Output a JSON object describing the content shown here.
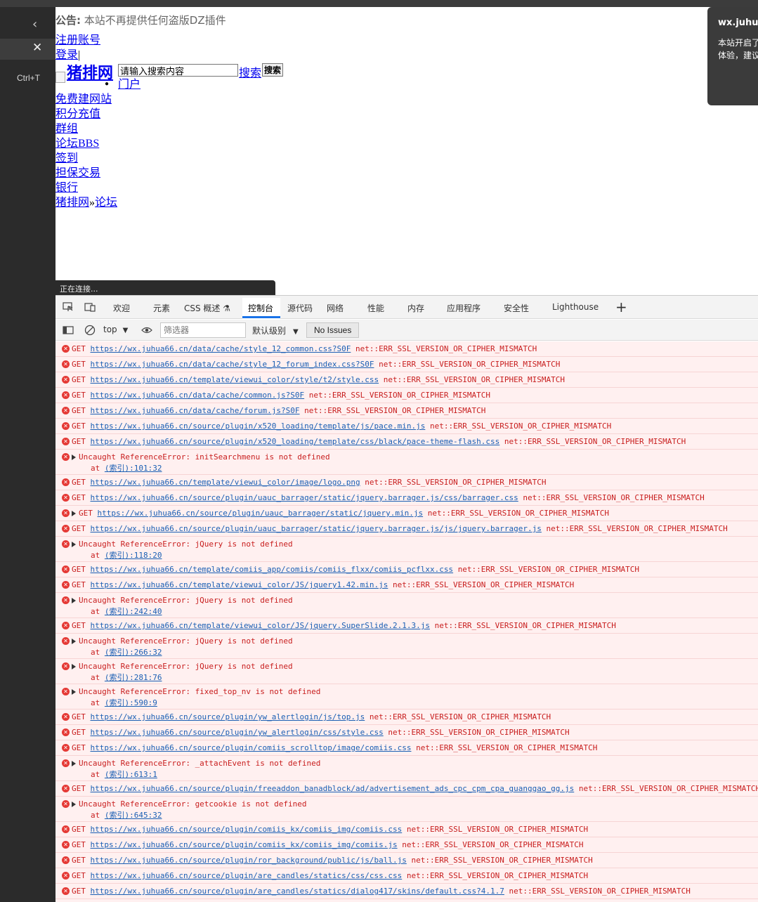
{
  "browser": {
    "shortcut": "Ctrl+T"
  },
  "page": {
    "notice_label": "公告:",
    "notice_text": "本站不再提供任何盗版DZ插件",
    "links_top": [
      "注册账号",
      "登录"
    ],
    "logo_text": "猪排网",
    "search_placeholder": "请输入搜索内容",
    "search_link": "搜索",
    "search_button": "搜索",
    "nav_items": [
      "门户",
      "免费建网站",
      "积分充值",
      "群组",
      "论坛BBS",
      "签到",
      "担保交易",
      "银行"
    ],
    "breadcrumb": [
      "猪排网",
      "»",
      "论坛"
    ],
    "status_text": "正在连接..."
  },
  "popup": {
    "title": "wx.juhua",
    "body": [
      "本站开启了",
      "体验，建议"
    ]
  },
  "devtools": {
    "tabs": [
      "欢迎",
      "元素",
      "CSS 概述",
      "控制台",
      "源代码",
      "网络",
      "性能",
      "内存",
      "应用程序",
      "安全性",
      "Lighthouse"
    ],
    "active_tab": "控制台",
    "context": "top",
    "filter_placeholder": "筛选器",
    "level": "默认级别",
    "issues": "No Issues"
  },
  "console": [
    {
      "kind": "get",
      "method": "GET",
      "url": "https://wx.juhua66.cn/data/cache/style_12_common.css?S0F",
      "error": "net::ERR_SSL_VERSION_OR_CIPHER_MISMATCH"
    },
    {
      "kind": "get",
      "method": "GET",
      "url": "https://wx.juhua66.cn/data/cache/style_12_forum_index.css?S0F",
      "error": "net::ERR_SSL_VERSION_OR_CIPHER_MISMATCH"
    },
    {
      "kind": "get",
      "method": "GET",
      "url": "https://wx.juhua66.cn/template/viewui_color/style/t2/style.css",
      "error": "net::ERR_SSL_VERSION_OR_CIPHER_MISMATCH"
    },
    {
      "kind": "get",
      "method": "GET",
      "url": "https://wx.juhua66.cn/data/cache/common.js?S0F",
      "error": "net::ERR_SSL_VERSION_OR_CIPHER_MISMATCH"
    },
    {
      "kind": "get",
      "method": "GET",
      "url": "https://wx.juhua66.cn/data/cache/forum.js?S0F",
      "error": "net::ERR_SSL_VERSION_OR_CIPHER_MISMATCH"
    },
    {
      "kind": "get",
      "method": "GET",
      "url": "https://wx.juhua66.cn/source/plugin/x520_loading/template/js/pace.min.js",
      "error": "net::ERR_SSL_VERSION_OR_CIPHER_MISMATCH"
    },
    {
      "kind": "get",
      "method": "GET",
      "url": "https://wx.juhua66.cn/source/plugin/x520_loading/template/css/black/pace-theme-flash.css",
      "error": "net::ERR_SSL_VERSION_OR_CIPHER_MISMATCH"
    },
    {
      "kind": "ref",
      "text": "Uncaught ReferenceError: initSearchmenu is not defined",
      "at": "at",
      "loc": "(索引):101:32"
    },
    {
      "kind": "get",
      "method": "GET",
      "url": "https://wx.juhua66.cn/template/viewui_color/image/logo.png",
      "error": "net::ERR_SSL_VERSION_OR_CIPHER_MISMATCH"
    },
    {
      "kind": "get",
      "method": "GET",
      "url": "https://wx.juhua66.cn/source/plugin/uauc_barrager/static/jquery.barrager.js/css/barrager.css",
      "error": "net::ERR_SSL_VERSION_OR_CIPHER_MISMATCH"
    },
    {
      "kind": "getx",
      "method": "GET",
      "url": "https://wx.juhua66.cn/source/plugin/uauc_barrager/static/jquery.min.js",
      "error": "net::ERR_SSL_VERSION_OR_CIPHER_MISMATCH"
    },
    {
      "kind": "get",
      "method": "GET",
      "url": "https://wx.juhua66.cn/source/plugin/uauc_barrager/static/jquery.barrager.js/js/jquery.barrager.js",
      "error": "net::ERR_SSL_VERSION_OR_CIPHER_MISMATCH"
    },
    {
      "kind": "ref",
      "text": "Uncaught ReferenceError: jQuery is not defined",
      "at": "at",
      "loc": "(索引):118:20"
    },
    {
      "kind": "get",
      "method": "GET",
      "url": "https://wx.juhua66.cn/template/comiis_app/comiis/comiis_flxx/comiis_pcflxx.css",
      "error": "net::ERR_SSL_VERSION_OR_CIPHER_MISMATCH"
    },
    {
      "kind": "get",
      "method": "GET",
      "url": "https://wx.juhua66.cn/template/viewui_color/JS/jquery1.42.min.js",
      "error": "net::ERR_SSL_VERSION_OR_CIPHER_MISMATCH"
    },
    {
      "kind": "ref",
      "text": "Uncaught ReferenceError: jQuery is not defined",
      "at": "at",
      "loc": "(索引):242:40"
    },
    {
      "kind": "get",
      "method": "GET",
      "url": "https://wx.juhua66.cn/template/viewui_color/JS/jquery.SuperSlide.2.1.3.js",
      "error": "net::ERR_SSL_VERSION_OR_CIPHER_MISMATCH"
    },
    {
      "kind": "ref",
      "text": "Uncaught ReferenceError: jQuery is not defined",
      "at": "at",
      "loc": "(索引):266:32"
    },
    {
      "kind": "ref",
      "text": "Uncaught ReferenceError: jQuery is not defined",
      "at": "at",
      "loc": "(索引):281:76"
    },
    {
      "kind": "ref",
      "text": "Uncaught ReferenceError: fixed_top_nv is not defined",
      "at": "at",
      "loc": "(索引):590:9"
    },
    {
      "kind": "get",
      "method": "GET",
      "url": "https://wx.juhua66.cn/source/plugin/yw_alertlogin/js/top.js",
      "error": "net::ERR_SSL_VERSION_OR_CIPHER_MISMATCH"
    },
    {
      "kind": "get",
      "method": "GET",
      "url": "https://wx.juhua66.cn/source/plugin/yw_alertlogin/css/style.css",
      "error": "net::ERR_SSL_VERSION_OR_CIPHER_MISMATCH"
    },
    {
      "kind": "get",
      "method": "GET",
      "url": "https://wx.juhua66.cn/source/plugin/comiis_scrolltop/image/comiis.css",
      "error": "net::ERR_SSL_VERSION_OR_CIPHER_MISMATCH"
    },
    {
      "kind": "ref",
      "text": "Uncaught ReferenceError: _attachEvent is not defined",
      "at": "at",
      "loc": "(索引):613:1"
    },
    {
      "kind": "get",
      "method": "GET",
      "url": "https://wx.juhua66.cn/source/plugin/freeaddon_banadblock/ad/advertisement_ads_cpc_cpm_cpa_guanggao_gg.js",
      "error": "net::ERR_SSL_VERSION_OR_CIPHER_MISMATCH"
    },
    {
      "kind": "ref",
      "text": "Uncaught ReferenceError: getcookie is not defined",
      "at": "at",
      "loc": "(索引):645:32"
    },
    {
      "kind": "get",
      "method": "GET",
      "url": "https://wx.juhua66.cn/source/plugin/comiis_kx/comiis_img/comiis.css",
      "error": "net::ERR_SSL_VERSION_OR_CIPHER_MISMATCH"
    },
    {
      "kind": "get",
      "method": "GET",
      "url": "https://wx.juhua66.cn/source/plugin/comiis_kx/comiis_img/comiis.js",
      "error": "net::ERR_SSL_VERSION_OR_CIPHER_MISMATCH"
    },
    {
      "kind": "get",
      "method": "GET",
      "url": "https://wx.juhua66.cn/source/plugin/ror_background/public/js/ball.js",
      "error": "net::ERR_SSL_VERSION_OR_CIPHER_MISMATCH"
    },
    {
      "kind": "get",
      "method": "GET",
      "url": "https://wx.juhua66.cn/source/plugin/are_candles/statics/css/css.css",
      "error": "net::ERR_SSL_VERSION_OR_CIPHER_MISMATCH"
    },
    {
      "kind": "get",
      "method": "GET",
      "url": "https://wx.juhua66.cn/source/plugin/are_candles/statics/dialog417/skins/default.css?4.1.7",
      "error": "net::ERR_SSL_VERSION_OR_CIPHER_MISMATCH"
    }
  ]
}
